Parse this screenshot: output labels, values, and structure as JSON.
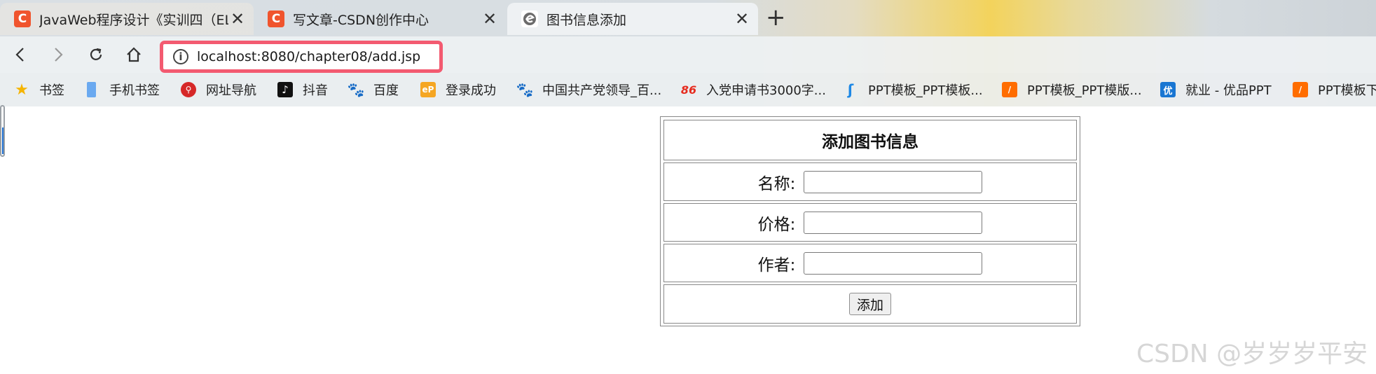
{
  "browser": {
    "tabs": [
      {
        "title": "JavaWeb程序设计《实训四（EL和",
        "icon": "csdn-c-icon"
      },
      {
        "title": "写文章-CSDN创作中心",
        "icon": "csdn-c-icon"
      },
      {
        "title": "图书信息添加",
        "icon": "page-e-icon"
      }
    ],
    "address": "localhost:8080/chapter08/add.jsp",
    "bookmarks": [
      {
        "label": "书签",
        "icon": "star-icon",
        "color": "#f5b400"
      },
      {
        "label": "手机书签",
        "icon": "phone-icon",
        "color": "#4a90e2"
      },
      {
        "label": "网址导航",
        "icon": "nav-icon",
        "color": "#d62828"
      },
      {
        "label": "抖音",
        "icon": "douyin-icon",
        "color": "#111111"
      },
      {
        "label": "百度",
        "icon": "baidu-paw-icon",
        "color": "#2932e1"
      },
      {
        "label": "登录成功",
        "icon": "ep-icon",
        "color": "#f5a623"
      },
      {
        "label": "中国共产党领导_百...",
        "icon": "baidu-paw-icon",
        "color": "#2932e1"
      },
      {
        "label": "入党申请书3000字...",
        "icon": "86-icon",
        "color": "#e62b1e"
      },
      {
        "label": "PPT模板_PPT模板...",
        "icon": "ppt-swirl-icon",
        "color": "#1e88e5"
      },
      {
        "label": "PPT模板_PPT模版...",
        "icon": "ppt-slash-icon",
        "color": "#ff6d00"
      },
      {
        "label": "就业 - 优品PPT",
        "icon": "youpin-icon",
        "color": "#1976d2"
      },
      {
        "label": "PPT模板下",
        "icon": "ppt-slash-icon",
        "color": "#ff6d00"
      }
    ]
  },
  "form": {
    "heading": "添加图书信息",
    "name_label": "名称:",
    "name_value": "",
    "price_label": "价格:",
    "price_value": "",
    "author_label": "作者:",
    "author_value": "",
    "submit_label": "添加"
  },
  "watermark": "CSDN @岁岁岁平安"
}
